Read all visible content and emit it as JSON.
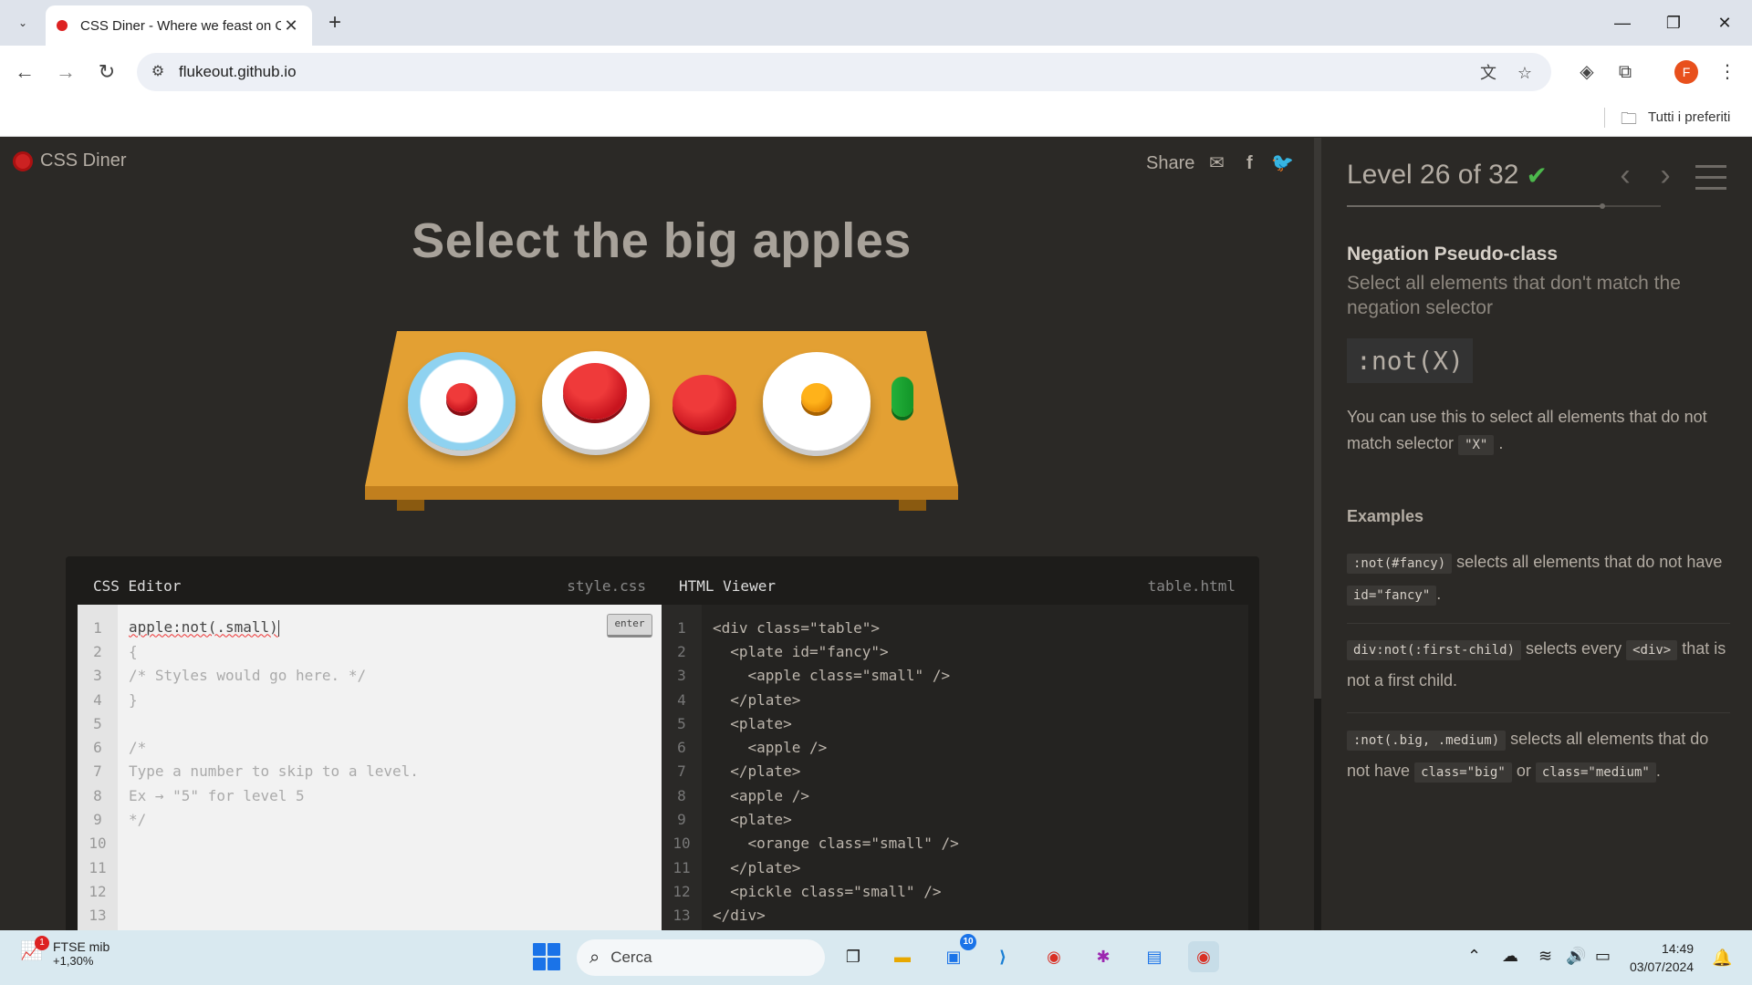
{
  "browser": {
    "tab_title": "CSS Diner - Where we feast on CSS Selectors!",
    "url": "flukeout.github.io",
    "bookmarks_label": "Tutti i preferiti",
    "profile_letter": "F"
  },
  "game": {
    "logo": "CSS Diner",
    "share_label": "Share",
    "instruction": "Select the big apples"
  },
  "editor": {
    "css_title": "CSS Editor",
    "css_file": "style.css",
    "enter_label": "enter",
    "css_input": "apple:not(.small)",
    "css_lines": [
      {
        "n": "1",
        "t": ""
      },
      {
        "n": "2",
        "t": "{"
      },
      {
        "n": "3",
        "t": "/* Styles would go here. */"
      },
      {
        "n": "4",
        "t": "}"
      },
      {
        "n": "5",
        "t": ""
      },
      {
        "n": "6",
        "t": "/*"
      },
      {
        "n": "7",
        "t": "Type a number to skip to a level."
      },
      {
        "n": "8",
        "t": "Ex → \"5\" for level 5"
      },
      {
        "n": "9",
        "t": "*/"
      },
      {
        "n": "10",
        "t": ""
      },
      {
        "n": "11",
        "t": ""
      },
      {
        "n": "12",
        "t": ""
      },
      {
        "n": "13",
        "t": ""
      }
    ],
    "html_title": "HTML Viewer",
    "html_file": "table.html",
    "html_lines": [
      {
        "n": "1",
        "t": "<div class=\"table\">"
      },
      {
        "n": "2",
        "t": "  <plate id=\"fancy\">"
      },
      {
        "n": "3",
        "t": "    <apple class=\"small\" />"
      },
      {
        "n": "4",
        "t": "  </plate>"
      },
      {
        "n": "5",
        "t": "  <plate>"
      },
      {
        "n": "6",
        "t": "    <apple />"
      },
      {
        "n": "7",
        "t": "  </plate>"
      },
      {
        "n": "8",
        "t": "  <apple />"
      },
      {
        "n": "9",
        "t": "  <plate>"
      },
      {
        "n": "10",
        "t": "    <orange class=\"small\" />"
      },
      {
        "n": "11",
        "t": "  </plate>"
      },
      {
        "n": "12",
        "t": "  <pickle class=\"small\" />"
      },
      {
        "n": "13",
        "t": "</div>"
      }
    ]
  },
  "sidebar": {
    "level_text": "Level 26 of 32",
    "level_current": 26,
    "level_total": 32,
    "completed": true,
    "selector_name": "Negation Pseudo-class",
    "title": "Select all elements that don't match the negation selector",
    "syntax": ":not(X)",
    "hint_before": "You can use this to select all elements that do not match selector",
    "hint_code": "\"X\"",
    "hint_after": ".",
    "examples_title": "Examples",
    "examples": [
      {
        "code": ":not(#fancy)",
        "text": "selects all elements that do not have",
        "code2": "id=\"fancy\"",
        "tail": "."
      },
      {
        "code": "div:not(:first-child)",
        "text": "selects every",
        "code2": "<div>",
        "tail": "that is not a first child."
      },
      {
        "code": ":not(.big, .medium)",
        "text": "selects all elements that do not have",
        "code2": "class=\"big\"",
        "mid": "or",
        "code3": "class=\"medium\"",
        "tail": "."
      }
    ]
  },
  "taskbar": {
    "stock_name": "FTSE mib",
    "stock_change": "+1,30%",
    "stock_badge": "1",
    "search_placeholder": "Cerca",
    "teams_badge": "10",
    "time": "14:49",
    "date": "03/07/2024"
  }
}
